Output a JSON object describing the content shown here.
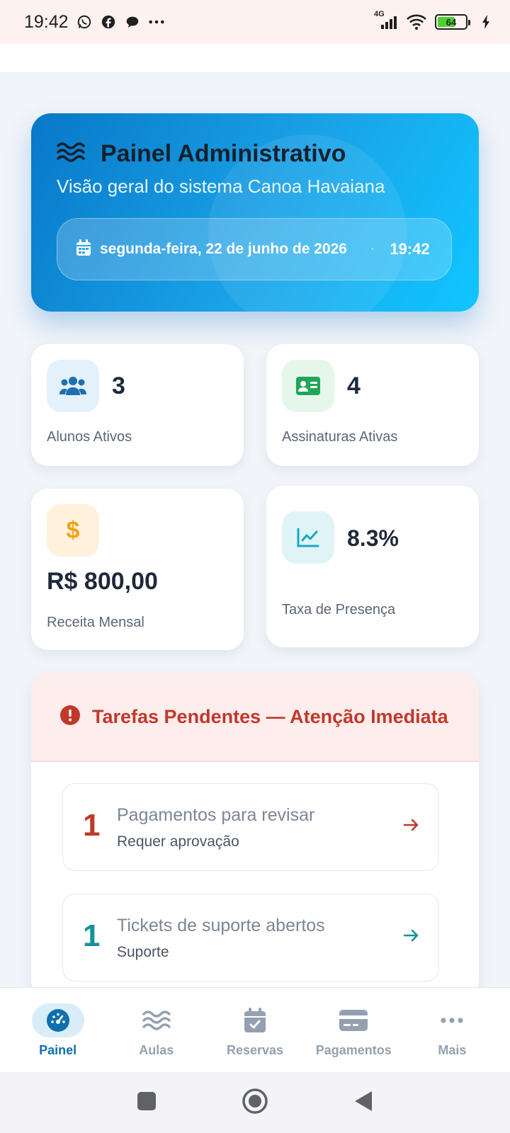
{
  "status_bar": {
    "time": "19:42",
    "network": "4G",
    "battery": "64",
    "battery_level_fraction": 0.64
  },
  "hero": {
    "title": "Painel Administrativo",
    "subtitle": "Visão geral do sistema Canoa Havaiana",
    "date": "segunda-feira, 22 de junho de 2026",
    "separator": "·",
    "time": "19:42"
  },
  "stats": [
    {
      "value": "3",
      "label": "Alunos Ativos",
      "icon": "users-icon",
      "color": "#1d6fb0",
      "bg": "#e3f1fb"
    },
    {
      "value": "4",
      "label": "Assinaturas Ativas",
      "icon": "id-card-icon",
      "color": "#22a559",
      "bg": "#e4f7ea"
    },
    {
      "value": "R$ 800,00",
      "label": "Receita Mensal",
      "icon": "dollar-icon",
      "color": "#f0a21a",
      "bg": "#fff1dc"
    },
    {
      "value": "8.3%",
      "label": "Taxa de Presença",
      "icon": "chart-line-icon",
      "color": "#1aa8c4",
      "bg": "#e0f4f8"
    }
  ],
  "tasks": {
    "title": "Tarefas Pendentes — Atenção Imediata",
    "items": [
      {
        "count": "1",
        "title": "Pagamentos para revisar",
        "subtitle": "Requer aprovação",
        "color": "#c0392b"
      },
      {
        "count": "1",
        "title": "Tickets de suporte abertos",
        "subtitle": "Suporte",
        "color": "#14919b"
      }
    ]
  },
  "bottom_nav": [
    {
      "label": "Painel",
      "icon": "dashboard-gauge-icon",
      "active": true
    },
    {
      "label": "Aulas",
      "icon": "waves-icon",
      "active": false
    },
    {
      "label": "Reservas",
      "icon": "calendar-check-icon",
      "active": false
    },
    {
      "label": "Pagamentos",
      "icon": "credit-card-icon",
      "active": false
    },
    {
      "label": "Mais",
      "icon": "more-dots-icon",
      "active": false
    }
  ]
}
